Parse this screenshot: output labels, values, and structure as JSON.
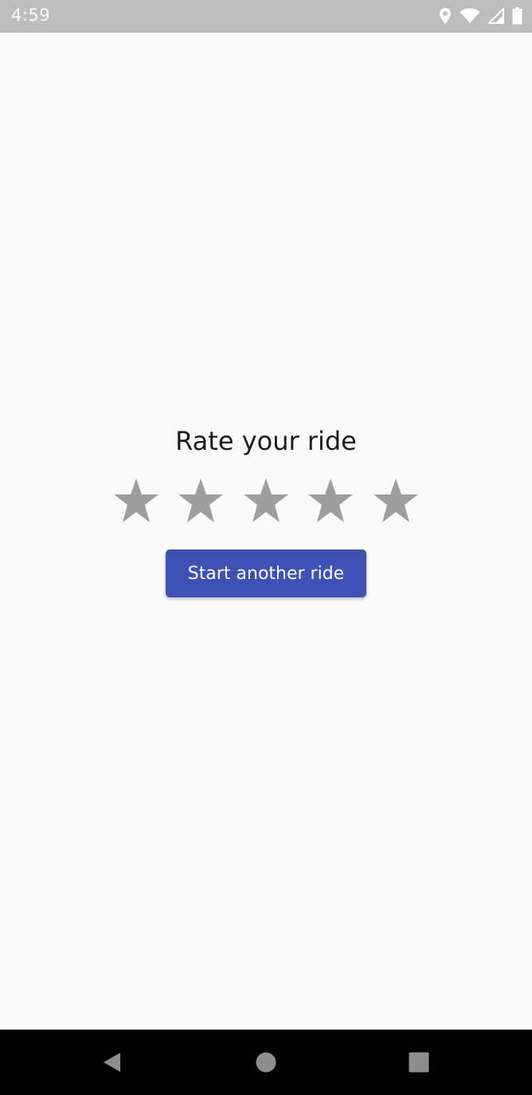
{
  "status_bar": {
    "time": "4:59",
    "icons": [
      "location-icon",
      "wifi-icon",
      "signal-icon",
      "battery-icon"
    ]
  },
  "rating": {
    "title": "Rate your ride",
    "max_stars": 5,
    "selected_stars": 0,
    "star_color": "#9e9e9e"
  },
  "actions": {
    "start_another_ride_label": "Start another ride",
    "button_color": "#3f51b5"
  },
  "nav_bar": {
    "buttons": [
      "back-icon",
      "home-icon",
      "recents-icon"
    ]
  }
}
